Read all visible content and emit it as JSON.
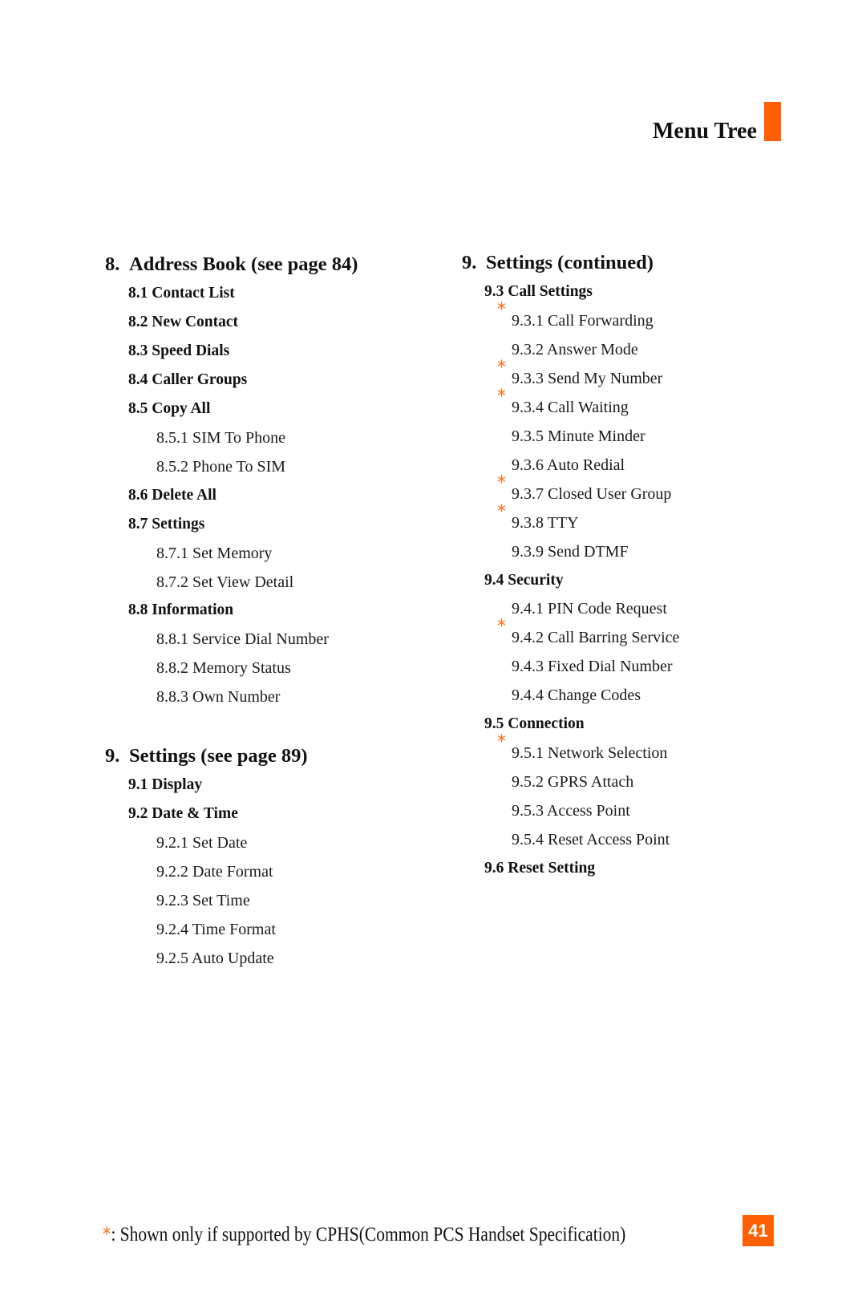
{
  "page_title": "Menu Tree",
  "accent_color": "#ff5f00",
  "left_column": [
    {
      "level": 1,
      "num": "8.",
      "label": "Address Book (see page 84)"
    },
    {
      "level": 2,
      "label": "8.1 Contact List"
    },
    {
      "level": 2,
      "label": "8.2 New Contact"
    },
    {
      "level": 2,
      "label": "8.3 Speed Dials"
    },
    {
      "level": 2,
      "label": "8.4 Caller Groups"
    },
    {
      "level": 2,
      "label": "8.5 Copy All"
    },
    {
      "level": 3,
      "label": "8.5.1 SIM To Phone"
    },
    {
      "level": 3,
      "label": "8.5.2 Phone To SIM"
    },
    {
      "level": 2,
      "label": "8.6 Delete All"
    },
    {
      "level": 2,
      "label": "8.7 Settings"
    },
    {
      "level": 3,
      "label": "8.7.1 Set Memory"
    },
    {
      "level": 3,
      "label": "8.7.2 Set View Detail"
    },
    {
      "level": 2,
      "label": "8.8 Information"
    },
    {
      "level": 3,
      "label": "8.8.1 Service Dial Number"
    },
    {
      "level": 3,
      "label": "8.8.2 Memory Status"
    },
    {
      "level": 3,
      "label": "8.8.3 Own Number"
    },
    {
      "level": 1,
      "num": "9.",
      "label": "Settings (see page 89)",
      "gap": true
    },
    {
      "level": 2,
      "label": "9.1 Display"
    },
    {
      "level": 2,
      "label": "9.2 Date & Time"
    },
    {
      "level": 3,
      "label": "9.2.1 Set Date"
    },
    {
      "level": 3,
      "label": "9.2.2 Date Format"
    },
    {
      "level": 3,
      "label": "9.2.3 Set Time"
    },
    {
      "level": 3,
      "label": "9.2.4 Time Format"
    },
    {
      "level": 3,
      "label": "9.2.5 Auto Update"
    }
  ],
  "right_column": [
    {
      "level": 1,
      "num": "9.",
      "label": "Settings (continued)"
    },
    {
      "level": 2,
      "label": "9.3 Call Settings"
    },
    {
      "level": 3,
      "label": "9.3.1 Call Forwarding",
      "cphs": true
    },
    {
      "level": 3,
      "label": "9.3.2 Answer Mode"
    },
    {
      "level": 3,
      "label": "9.3.3 Send My Number",
      "cphs": true
    },
    {
      "level": 3,
      "label": "9.3.4 Call Waiting",
      "cphs": true
    },
    {
      "level": 3,
      "label": "9.3.5 Minute Minder"
    },
    {
      "level": 3,
      "label": "9.3.6 Auto Redial"
    },
    {
      "level": 3,
      "label": "9.3.7 Closed User Group",
      "cphs": true
    },
    {
      "level": 3,
      "label": "9.3.8 TTY",
      "cphs": true
    },
    {
      "level": 3,
      "label": "9.3.9 Send DTMF"
    },
    {
      "level": 2,
      "label": "9.4 Security"
    },
    {
      "level": 3,
      "label": "9.4.1 PIN Code Request"
    },
    {
      "level": 3,
      "label": "9.4.2 Call Barring Service",
      "cphs": true
    },
    {
      "level": 3,
      "label": "9.4.3 Fixed Dial Number"
    },
    {
      "level": 3,
      "label": "9.4.4 Change Codes"
    },
    {
      "level": 2,
      "label": "9.5 Connection"
    },
    {
      "level": 3,
      "label": "9.5.1 Network Selection",
      "cphs": true
    },
    {
      "level": 3,
      "label": "9.5.2 GPRS Attach"
    },
    {
      "level": 3,
      "label": "9.5.3 Access Point"
    },
    {
      "level": 3,
      "label": "9.5.4 Reset Access Point"
    },
    {
      "level": 2,
      "label": "9.6 Reset Setting"
    }
  ],
  "asterisk_symbol": "*",
  "footer": {
    "symbol": "*",
    "note": ": Shown only if supported by CPHS(Common PCS Handset Specification)"
  },
  "page_number": "41"
}
